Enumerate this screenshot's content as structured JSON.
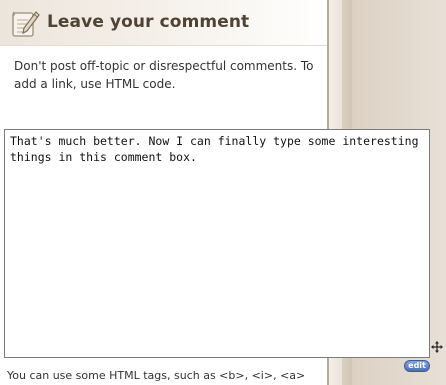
{
  "header": {
    "title": "Leave your comment",
    "icon": "paper-pencil-icon"
  },
  "intro": {
    "text": "Don't post off-topic or disrespectful comments. To add a link, use HTML code."
  },
  "comment": {
    "value": "That's much better. Now I can finally type some interesting things in this comment box."
  },
  "edit_badge": {
    "label": "edit"
  },
  "note": {
    "text": "You can use some HTML tags, such as <b>, <i>, <a>"
  },
  "colors": {
    "title": "#4e4335",
    "edit_badge": "#4f6fb3"
  }
}
